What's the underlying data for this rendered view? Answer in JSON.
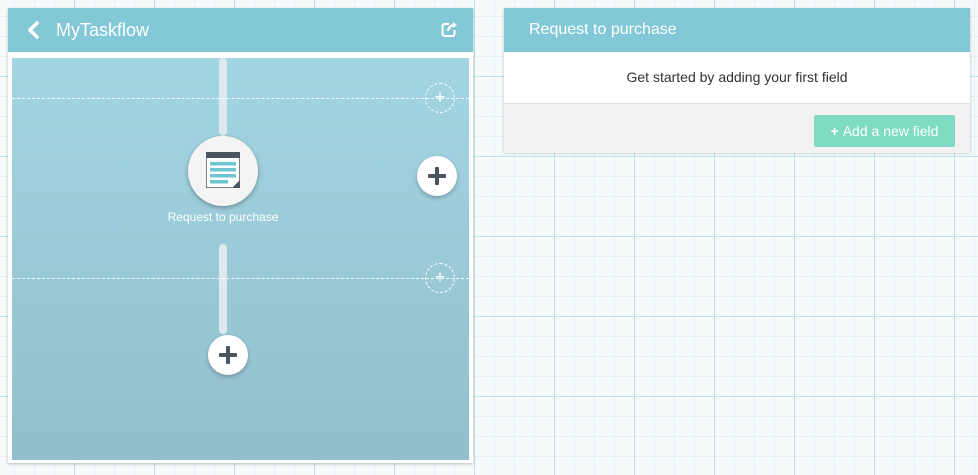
{
  "taskflow": {
    "title": "MyTaskflow",
    "steps": [
      {
        "label": "Request to purchase"
      }
    ],
    "add_symbol": "+"
  },
  "form": {
    "title": "Request to purchase",
    "empty_message": "Get started by adding your first field",
    "add_button_label": "Add a new field",
    "add_button_icon": "+"
  },
  "icons": {
    "back": "chevron-left-icon",
    "export": "share-icon",
    "step": "form-icon",
    "add": "plus-icon"
  },
  "colors": {
    "header": "#82c8d6",
    "canvas_top": "#a3d5e2",
    "canvas_bottom": "#92bfcc",
    "add_button": "#7fdcc3"
  }
}
